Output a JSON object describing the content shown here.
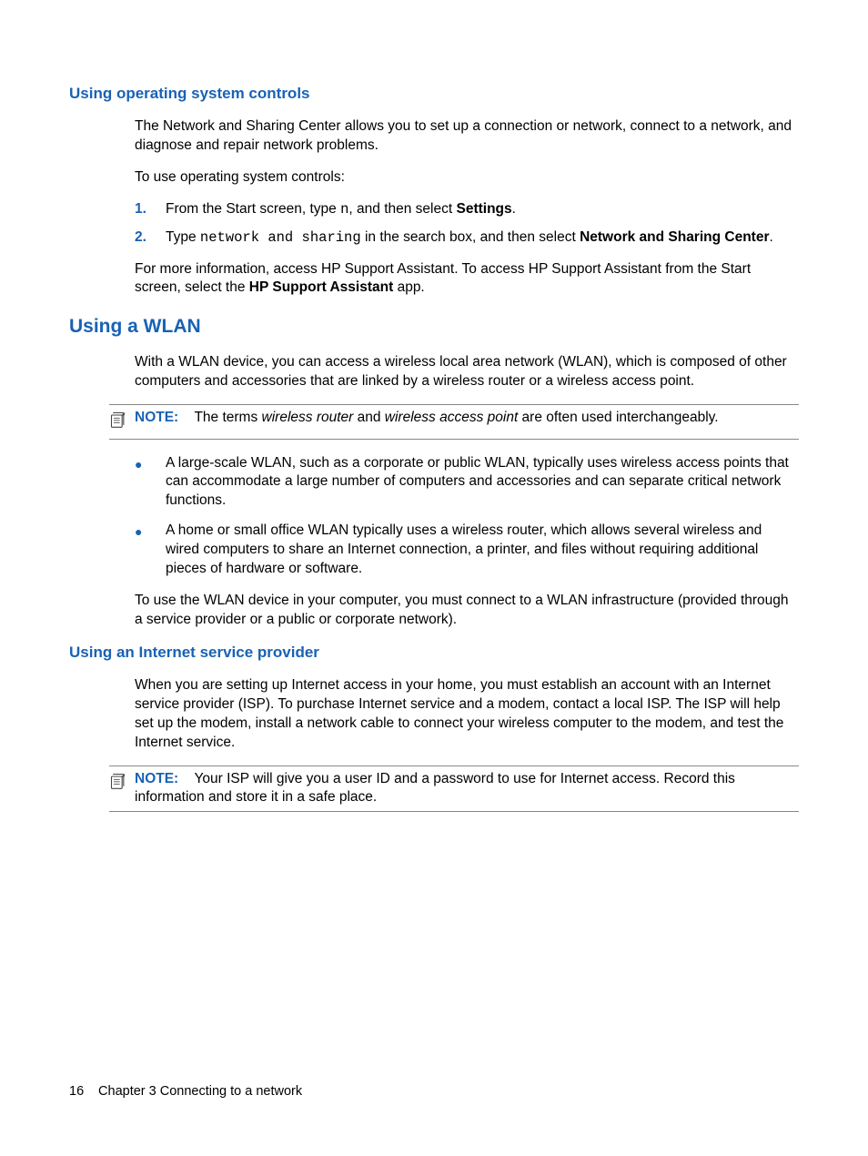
{
  "sections": {
    "os_controls": {
      "heading": "Using operating system controls",
      "intro": "The Network and Sharing Center allows you to set up a connection or network, connect to a network, and diagnose and repair network problems.",
      "lead": "To use operating system controls:",
      "steps": {
        "n1": "1.",
        "s1a": "From the Start screen, type ",
        "s1b_code": "n",
        "s1c": ", and then select ",
        "s1d_bold": "Settings",
        "s1e": ".",
        "n2": "2.",
        "s2a": "Type ",
        "s2b_code": "network and sharing",
        "s2c": " in the search box, and then select ",
        "s2d_bold": "Network and Sharing Center",
        "s2e": "."
      },
      "more_a": "For more information, access HP Support Assistant. To access HP Support Assistant from the Start screen, select the ",
      "more_b_bold": "HP Support Assistant",
      "more_c": " app."
    },
    "wlan": {
      "heading": "Using a WLAN",
      "intro": "With a WLAN device, you can access a wireless local area network (WLAN), which is composed of other computers and accessories that are linked by a wireless router or a wireless access point.",
      "note_label": "NOTE:",
      "note_a": "The terms ",
      "note_b_it": "wireless router",
      "note_c": " and ",
      "note_d_it": "wireless access point",
      "note_e": " are often used interchangeably.",
      "bullet1": "A large-scale WLAN, such as a corporate or public WLAN, typically uses wireless access points that can accommodate a large number of computers and accessories and can separate critical network functions.",
      "bullet2": "A home or small office WLAN typically uses a wireless router, which allows several wireless and wired computers to share an Internet connection, a printer, and files without requiring additional pieces of hardware or software.",
      "tail": "To use the WLAN device in your computer, you must connect to a WLAN infrastructure (provided through a service provider or a public or corporate network)."
    },
    "isp": {
      "heading": "Using an Internet service provider",
      "intro": "When you are setting up Internet access in your home, you must establish an account with an Internet service provider (ISP). To purchase Internet service and a modem, contact a local ISP. The ISP will help set up the modem, install a network cable to connect your wireless computer to the modem, and test the Internet service.",
      "note_label": "NOTE:",
      "note_body": "Your ISP will give you a user ID and a password to use for Internet access. Record this information and store it in a safe place."
    }
  },
  "footer": {
    "page": "16",
    "chapter": "Chapter 3   Connecting to a network"
  },
  "glyphs": {
    "bullet": "●"
  }
}
